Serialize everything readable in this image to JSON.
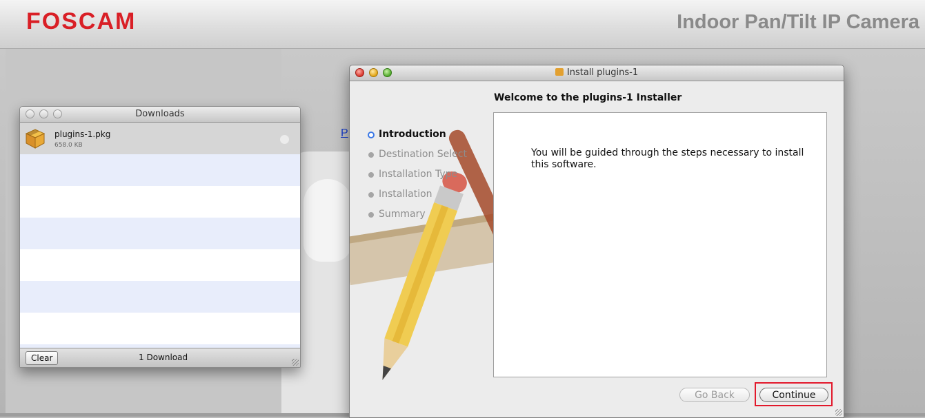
{
  "banner": {
    "logo": "FOSCAM",
    "product_title": "Indoor Pan/Tilt IP Camera"
  },
  "webpage": {
    "link_fragment": "P"
  },
  "downloads_window": {
    "title": "Downloads",
    "items": [
      {
        "name": "plugins-1.pkg",
        "size": "658.0 KB",
        "icon": "package-icon"
      }
    ],
    "clear_label": "Clear",
    "count_label": "1 Download"
  },
  "installer_window": {
    "title": "Install plugins-1",
    "heading": "Welcome to the plugins-1 Installer",
    "steps": [
      {
        "label": "Introduction",
        "active": true
      },
      {
        "label": "Destination Select",
        "active": false
      },
      {
        "label": "Installation Type",
        "active": false
      },
      {
        "label": "Installation",
        "active": false
      },
      {
        "label": "Summary",
        "active": false
      }
    ],
    "body_text": "You will be guided through the steps necessary to install this software.",
    "go_back_label": "Go Back",
    "continue_label": "Continue",
    "highlight_color": "#e2182b"
  }
}
